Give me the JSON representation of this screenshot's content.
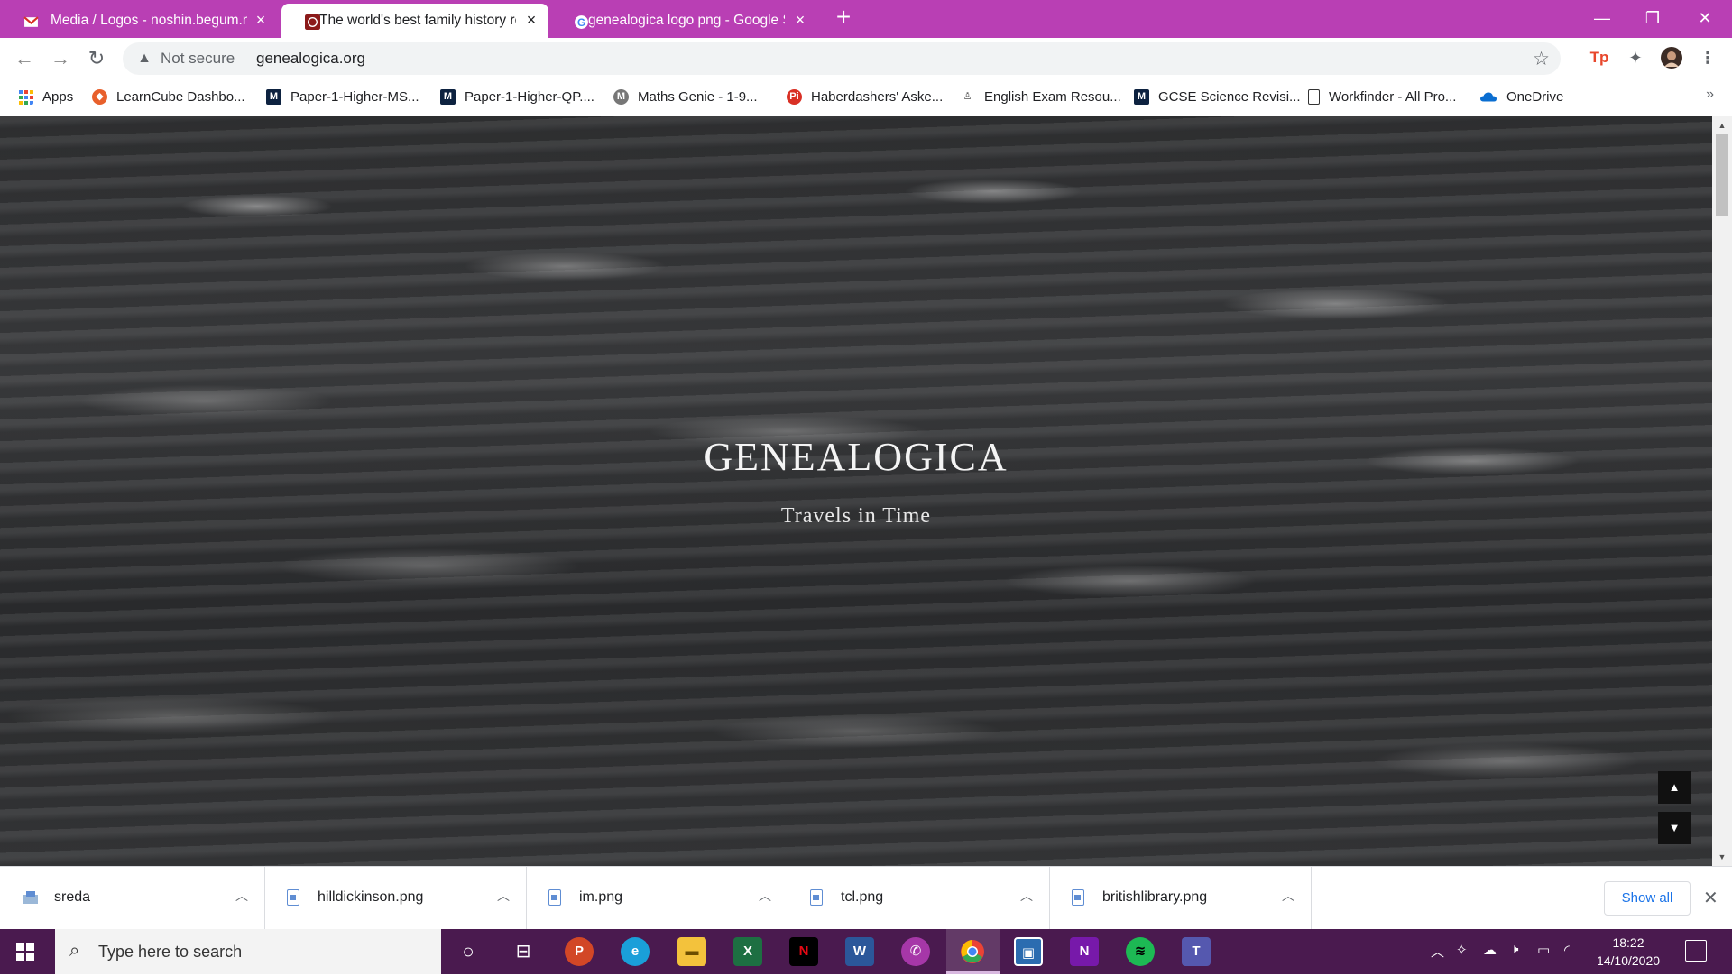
{
  "browser": {
    "tabs": [
      {
        "title": "Media / Logos - noshin.begum.n",
        "icon": "gmail-icon",
        "active": false
      },
      {
        "title": "The world's best family history re",
        "icon": "site-icon",
        "active": true
      },
      {
        "title": "genealogica logo png - Google S",
        "icon": "google-icon",
        "active": false
      }
    ],
    "new_tab_label": "+",
    "address": {
      "security_label": "Not secure",
      "url": "genealogica.org"
    },
    "bookmarks": [
      {
        "label": "Apps",
        "icon": "apps-grid-icon"
      },
      {
        "label": "LearnCube Dashbo...",
        "icon": "learncube-icon"
      },
      {
        "label": "Paper-1-Higher-MS...",
        "icon": "m-icon"
      },
      {
        "label": "Paper-1-Higher-QP....",
        "icon": "m-icon"
      },
      {
        "label": "Maths Genie - 1-9...",
        "icon": "maths-genie-icon"
      },
      {
        "label": "Haberdashers' Aske...",
        "icon": "pi-icon"
      },
      {
        "label": "English Exam Resou...",
        "icon": "english-icon"
      },
      {
        "label": "GCSE Science Revisi...",
        "icon": "m-icon"
      },
      {
        "label": "Workfinder - All Pro...",
        "icon": "workfinder-icon"
      },
      {
        "label": "OneDrive",
        "icon": "onedrive-icon"
      }
    ]
  },
  "page": {
    "title": "GENEALOGICA",
    "subtitle": "Travels in Time"
  },
  "downloads": {
    "items": [
      {
        "name": "sreda"
      },
      {
        "name": "hilldickinson.png"
      },
      {
        "name": "im.png"
      },
      {
        "name": "tcl.png"
      },
      {
        "name": "britishlibrary.png"
      }
    ],
    "show_all_label": "Show all"
  },
  "taskbar": {
    "search_placeholder": "Type here to search",
    "time": "18:22",
    "date": "14/10/2020"
  },
  "colors": {
    "tabstrip": "#b93fb4",
    "taskbar": "#4a1a4f",
    "link": "#1a73e8"
  }
}
